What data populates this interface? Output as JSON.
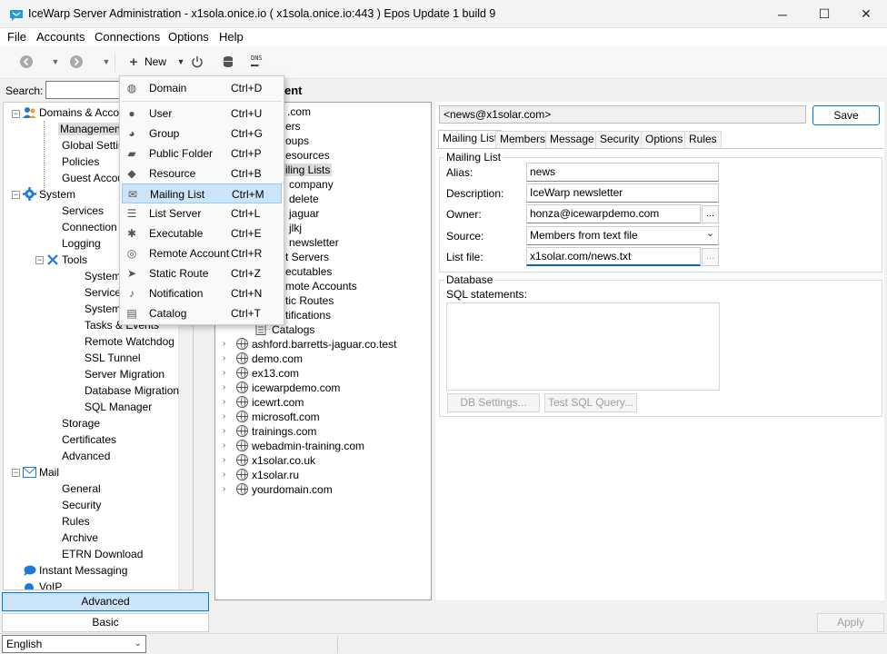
{
  "window": {
    "title": "IceWarp Server Administration - x1sola.onice.io ( x1sola.onice.io:443 ) Epos Update 1 build 9",
    "minimize": "─",
    "maximize": "☐",
    "close": "✕"
  },
  "menubar": [
    "File",
    "Accounts",
    "Connections",
    "Options",
    "Help"
  ],
  "toolbar": {
    "new_label": "New",
    "dns_label": "DNS"
  },
  "search": {
    "label": "Search:",
    "value": ""
  },
  "left_tree": {
    "items": [
      "Domains & Accounts",
      "Management",
      "Global Settings",
      "Policies",
      "Guest Accounts",
      "System",
      "Services",
      "Connection",
      "Logging",
      "Tools",
      "System Backup",
      "Service Monitor",
      "System Log",
      "Tasks & Events",
      "Remote Watchdog",
      "SSL Tunnel",
      "Server Migration",
      "Database Migration",
      "SQL Manager",
      "Storage",
      "Certificates",
      "Advanced",
      "Mail",
      "General",
      "Security",
      "Rules",
      "Archive",
      "ETRN Download",
      "Instant Messaging",
      "VoIP"
    ]
  },
  "left_buttons": {
    "advanced": "Advanced",
    "basic": "Basic"
  },
  "language": "English",
  "mid": {
    "header": "ent",
    "partial_items": [
      ".com",
      "ers",
      "oups",
      "esources",
      "iling Lists",
      "company",
      "delete",
      "jaguar",
      "jlkj",
      "newsletter",
      "t Servers",
      "ecutables",
      "mote Accounts",
      "tic Routes",
      "tifications"
    ],
    "catalogs": "Catalogs",
    "domains": [
      "ashford.barretts-jaguar.co.test",
      "demo.com",
      "ex13.com",
      "icewarpdemo.com",
      "icewrt.com",
      "microsoft.com",
      "trainings.com",
      "webadmin-training.com",
      "x1solar.co.uk",
      "x1solar.ru",
      "yourdomain.com"
    ]
  },
  "right": {
    "address": "<news@x1solar.com>",
    "save": "Save",
    "tabs": [
      "Mailing List",
      "Members",
      "Message",
      "Security",
      "Options",
      "Rules"
    ],
    "mailing_group": "Mailing List",
    "fields": {
      "alias_label": "Alias:",
      "alias": "news",
      "description_label": "Description:",
      "description": "IceWarp newsletter",
      "owner_label": "Owner:",
      "owner": "honza@icewarpdemo.com",
      "source_label": "Source:",
      "source": "Members from text file",
      "listfile_label": "List file:",
      "listfile": "x1solar.com/news.txt"
    },
    "dots": "...",
    "db_group": "Database",
    "sql_label": "SQL statements:",
    "db_settings": "DB Settings...",
    "test_sql": "Test SQL Query..."
  },
  "apply": "Apply",
  "new_menu": [
    {
      "icon": "globe-icon",
      "label": "Domain",
      "shortcut": "Ctrl+D"
    },
    {
      "icon": "user-icon",
      "label": "User",
      "shortcut": "Ctrl+U"
    },
    {
      "icon": "group-icon",
      "label": "Group",
      "shortcut": "Ctrl+G"
    },
    {
      "icon": "folder-icon",
      "label": "Public Folder",
      "shortcut": "Ctrl+P"
    },
    {
      "icon": "resource-icon",
      "label": "Resource",
      "shortcut": "Ctrl+B"
    },
    {
      "icon": "envelope-icon",
      "label": "Mailing List",
      "shortcut": "Ctrl+M"
    },
    {
      "icon": "server-icon",
      "label": "List Server",
      "shortcut": "Ctrl+L"
    },
    {
      "icon": "gear-icon",
      "label": "Executable",
      "shortcut": "Ctrl+E"
    },
    {
      "icon": "remote-icon",
      "label": "Remote Account",
      "shortcut": "Ctrl+R"
    },
    {
      "icon": "route-icon",
      "label": "Static Route",
      "shortcut": "Ctrl+Z"
    },
    {
      "icon": "bell-icon",
      "label": "Notification",
      "shortcut": "Ctrl+N"
    },
    {
      "icon": "catalog-icon",
      "label": "Catalog",
      "shortcut": "Ctrl+T"
    }
  ]
}
